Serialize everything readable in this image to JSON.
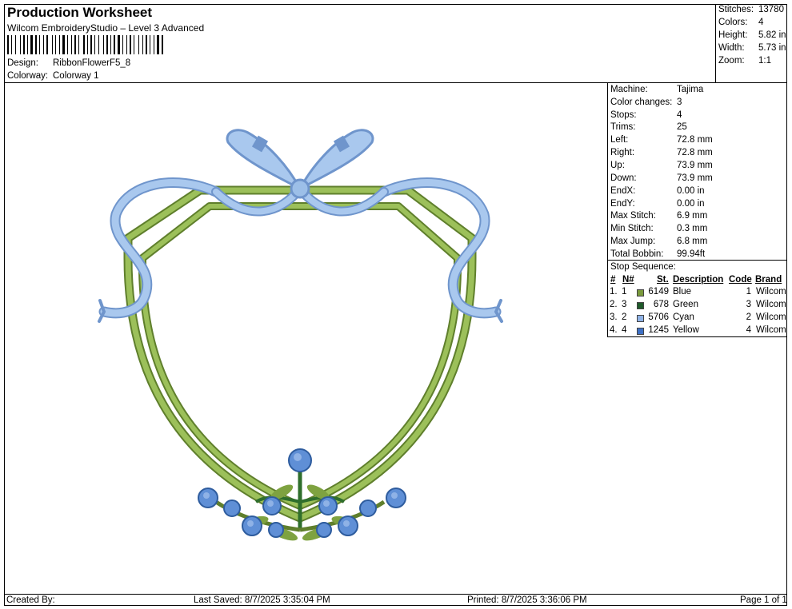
{
  "header": {
    "title": "Production Worksheet",
    "subtitle": "Wilcom EmbroideryStudio – Level 3 Advanced",
    "design_label": "Design:",
    "design_value": "RibbonFlowerF5_8",
    "colorway_label": "Colorway:",
    "colorway_value": "Colorway 1"
  },
  "stats": [
    {
      "label": "Stitches:",
      "value": "13780"
    },
    {
      "label": "Colors:",
      "value": "4"
    },
    {
      "label": "Height:",
      "value": "5.82 in"
    },
    {
      "label": "Width:",
      "value": "5.73 in"
    },
    {
      "label": "Zoom:",
      "value": "1:1"
    }
  ],
  "machine_info": [
    {
      "label": "Machine:",
      "value": "Tajima"
    },
    {
      "label": "Color changes:",
      "value": "3"
    },
    {
      "label": "Stops:",
      "value": "4"
    },
    {
      "label": "Trims:",
      "value": "25"
    },
    {
      "label": "Left:",
      "value": "72.8 mm"
    },
    {
      "label": "Right:",
      "value": "72.8 mm"
    },
    {
      "label": "Up:",
      "value": "73.9 mm"
    },
    {
      "label": "Down:",
      "value": "73.9 mm"
    },
    {
      "label": "EndX:",
      "value": "0.00 in"
    },
    {
      "label": "EndY:",
      "value": "0.00 in"
    },
    {
      "label": "Max Stitch:",
      "value": "6.9 mm"
    },
    {
      "label": "Min Stitch:",
      "value": "0.3 mm"
    },
    {
      "label": "Max Jump:",
      "value": "6.8 mm"
    },
    {
      "label": "Total Bobbin:",
      "value": "99.94ft"
    }
  ],
  "stop_sequence": {
    "title": "Stop Sequence:",
    "headers": {
      "num": "#",
      "n": "N#",
      "st": "St.",
      "description": "Description",
      "code": "Code",
      "brand": "Brand"
    },
    "rows": [
      {
        "num": "1.",
        "n": "1",
        "color": "#7a9a3c",
        "st": "6149",
        "description": "Blue",
        "code": "1",
        "brand": "Wilcom"
      },
      {
        "num": "2.",
        "n": "3",
        "color": "#1f5a2a",
        "st": "678",
        "description": "Green",
        "code": "3",
        "brand": "Wilcom"
      },
      {
        "num": "3.",
        "n": "2",
        "color": "#8fb2e6",
        "st": "5706",
        "description": "Cyan",
        "code": "2",
        "brand": "Wilcom"
      },
      {
        "num": "4.",
        "n": "4",
        "color": "#3d6fc4",
        "st": "1245",
        "description": "Yellow",
        "code": "4",
        "brand": "Wilcom"
      }
    ]
  },
  "footer": {
    "created_by": "Created By:",
    "last_saved": "Last Saved: 8/7/2025 3:35:04 PM",
    "printed": "Printed: 8/7/2025 3:36:06 PM",
    "page": "Page 1 of 1"
  },
  "colors": {
    "frame_green": "#88a848",
    "frame_green_dark": "#5f7f2c",
    "ribbon_blue": "#9cbfe8",
    "ribbon_blue_dark": "#6f95cc",
    "flower_blue": "#5f8fd6",
    "leaf_green": "#2f6e2c"
  }
}
